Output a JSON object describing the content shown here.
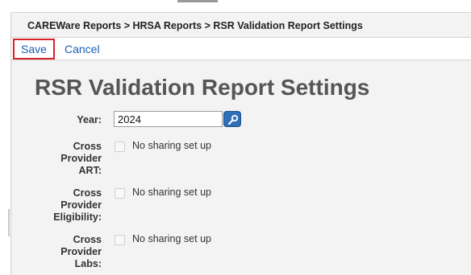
{
  "breadcrumb": "CAREWare Reports > HRSA Reports > RSR Validation Report Settings",
  "toolbar": {
    "save_label": "Save",
    "cancel_label": "Cancel"
  },
  "title": "RSR Validation Report Settings",
  "fields": {
    "year": {
      "label": "Year:",
      "value": "2024"
    },
    "cross_provider_art": {
      "label_line1": "Cross",
      "label_line2": "Provider",
      "label_line3": "ART:",
      "option_text": "No sharing set up",
      "checked": false
    },
    "cross_provider_eligibility": {
      "label_line1": "Cross",
      "label_line2": "Provider",
      "label_line3": "Eligibility:",
      "option_text": "No sharing set up",
      "checked": false
    },
    "cross_provider_labs": {
      "label_line1": "Cross",
      "label_line2": "Provider",
      "label_line3": "Labs:",
      "option_text": "No sharing set up",
      "checked": false
    }
  },
  "colors": {
    "link": "#1a5fb4",
    "highlight": "#d8232a",
    "lookup_button": "#2e6fb8"
  },
  "icons": {
    "lookup": "lookup-icon"
  }
}
